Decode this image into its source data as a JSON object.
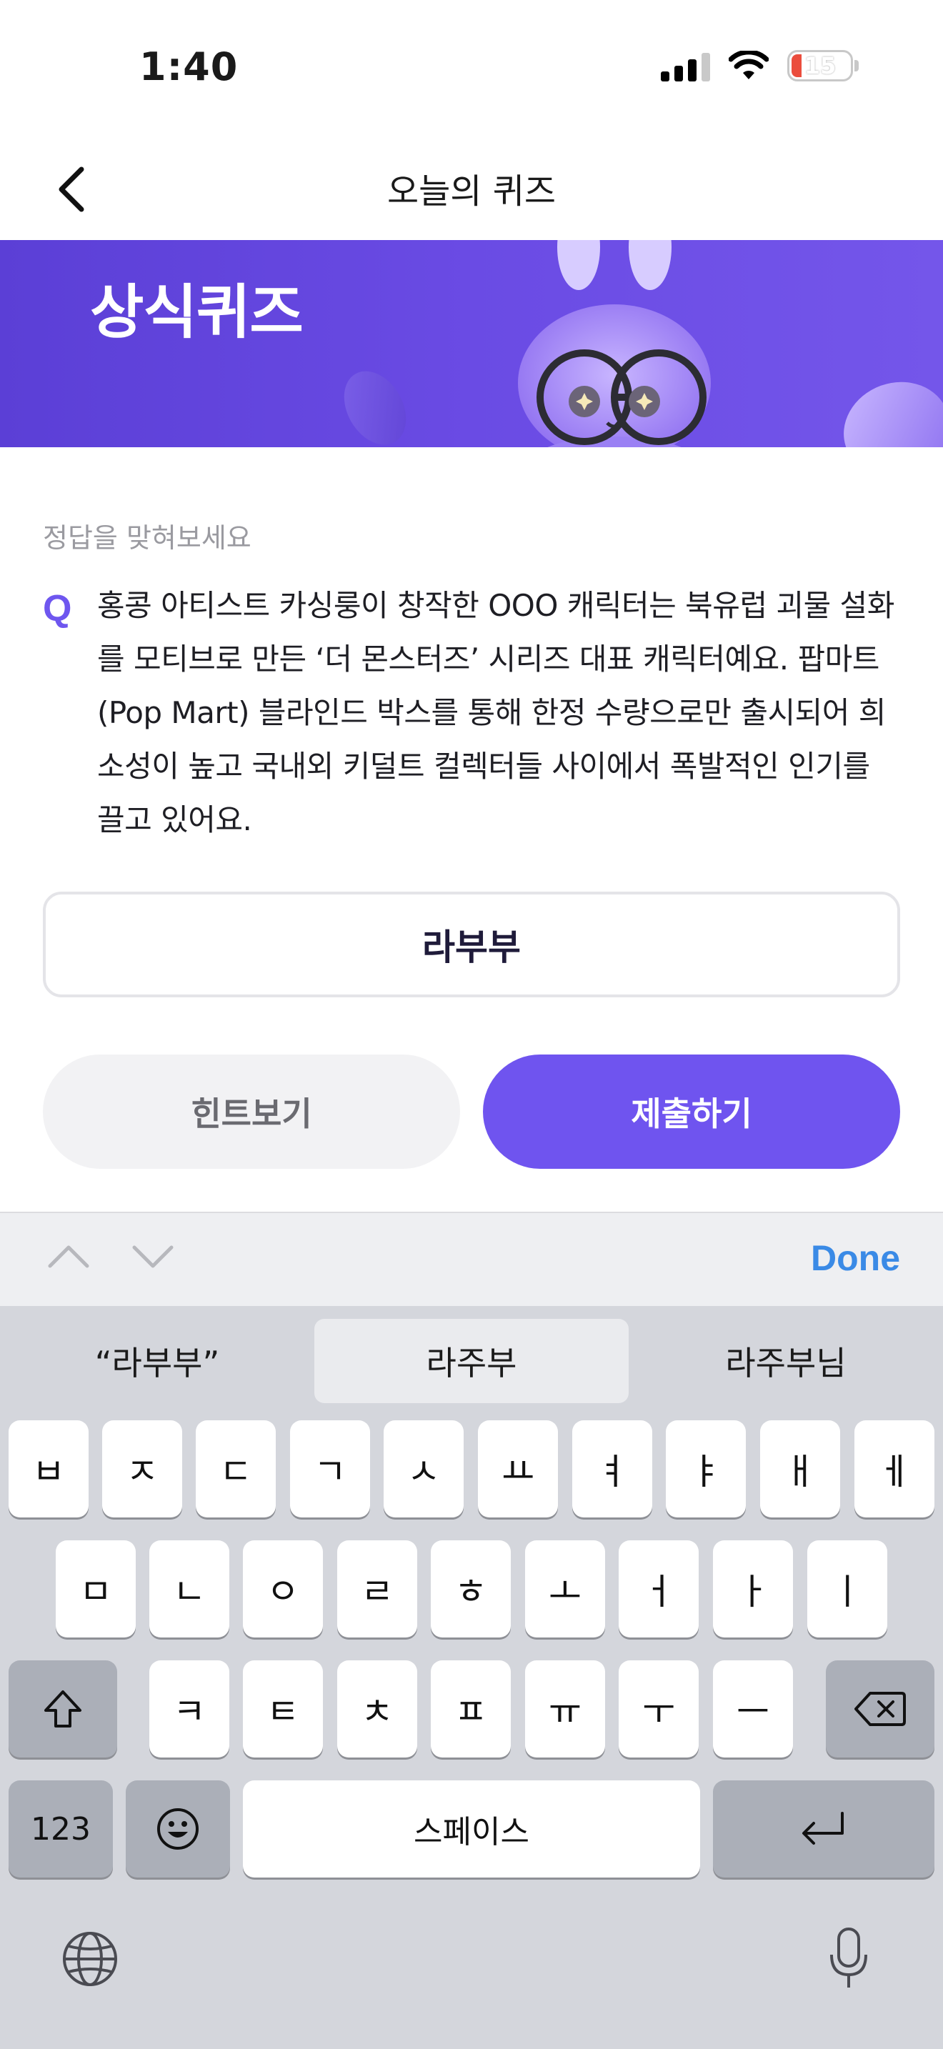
{
  "status_bar": {
    "time": "1:40",
    "battery": "15"
  },
  "header": {
    "title": "오늘의 퀴즈"
  },
  "banner": {
    "title_line2": "상식퀴즈",
    "bg_color": "#6a4be4"
  },
  "quiz": {
    "instruction": "정답을 맞혀보세요",
    "q_mark": "Q",
    "question": "홍콩 아티스트 카싱룽이 창작한 OOO 캐릭터는 북유럽 괴물 설화를 모티브로 만든 ‘더 몬스터즈’ 시리즈 대표 캐릭터예요. 팝마트(Pop Mart) 블라인드 박스를 통해 한정 수량으로만 출시되어 희소성이 높고 국내외 키덜트 컬렉터들 사이에서 폭발적인 인기를 끌고 있어요.",
    "answer_value": "라부부",
    "hint_button": "힌트보기",
    "submit_button": "제출하기",
    "accent_color": "#6f54ef"
  },
  "keyboard": {
    "done": "Done",
    "suggestions": [
      "“라부부”",
      "라주부",
      "라주부님"
    ],
    "row1": [
      "ㅂ",
      "ㅈ",
      "ㄷ",
      "ㄱ",
      "ㅅ",
      "ㅛ",
      "ㅕ",
      "ㅑ",
      "ㅐ",
      "ㅔ"
    ],
    "row2": [
      "ㅁ",
      "ㄴ",
      "ㅇ",
      "ㄹ",
      "ㅎ",
      "ㅗ",
      "ㅓ",
      "ㅏ",
      "ㅣ"
    ],
    "row3": [
      "ㅋ",
      "ㅌ",
      "ㅊ",
      "ㅍ",
      "ㅠ",
      "ㅜ",
      "ㅡ"
    ],
    "numbers": "123",
    "space": "스페이스",
    "icons": {
      "shift": "shift-icon",
      "backspace": "backspace-icon",
      "emoji": "emoji-icon",
      "return": "return-icon",
      "globe": "globe-icon",
      "mic": "microphone-icon"
    }
  }
}
